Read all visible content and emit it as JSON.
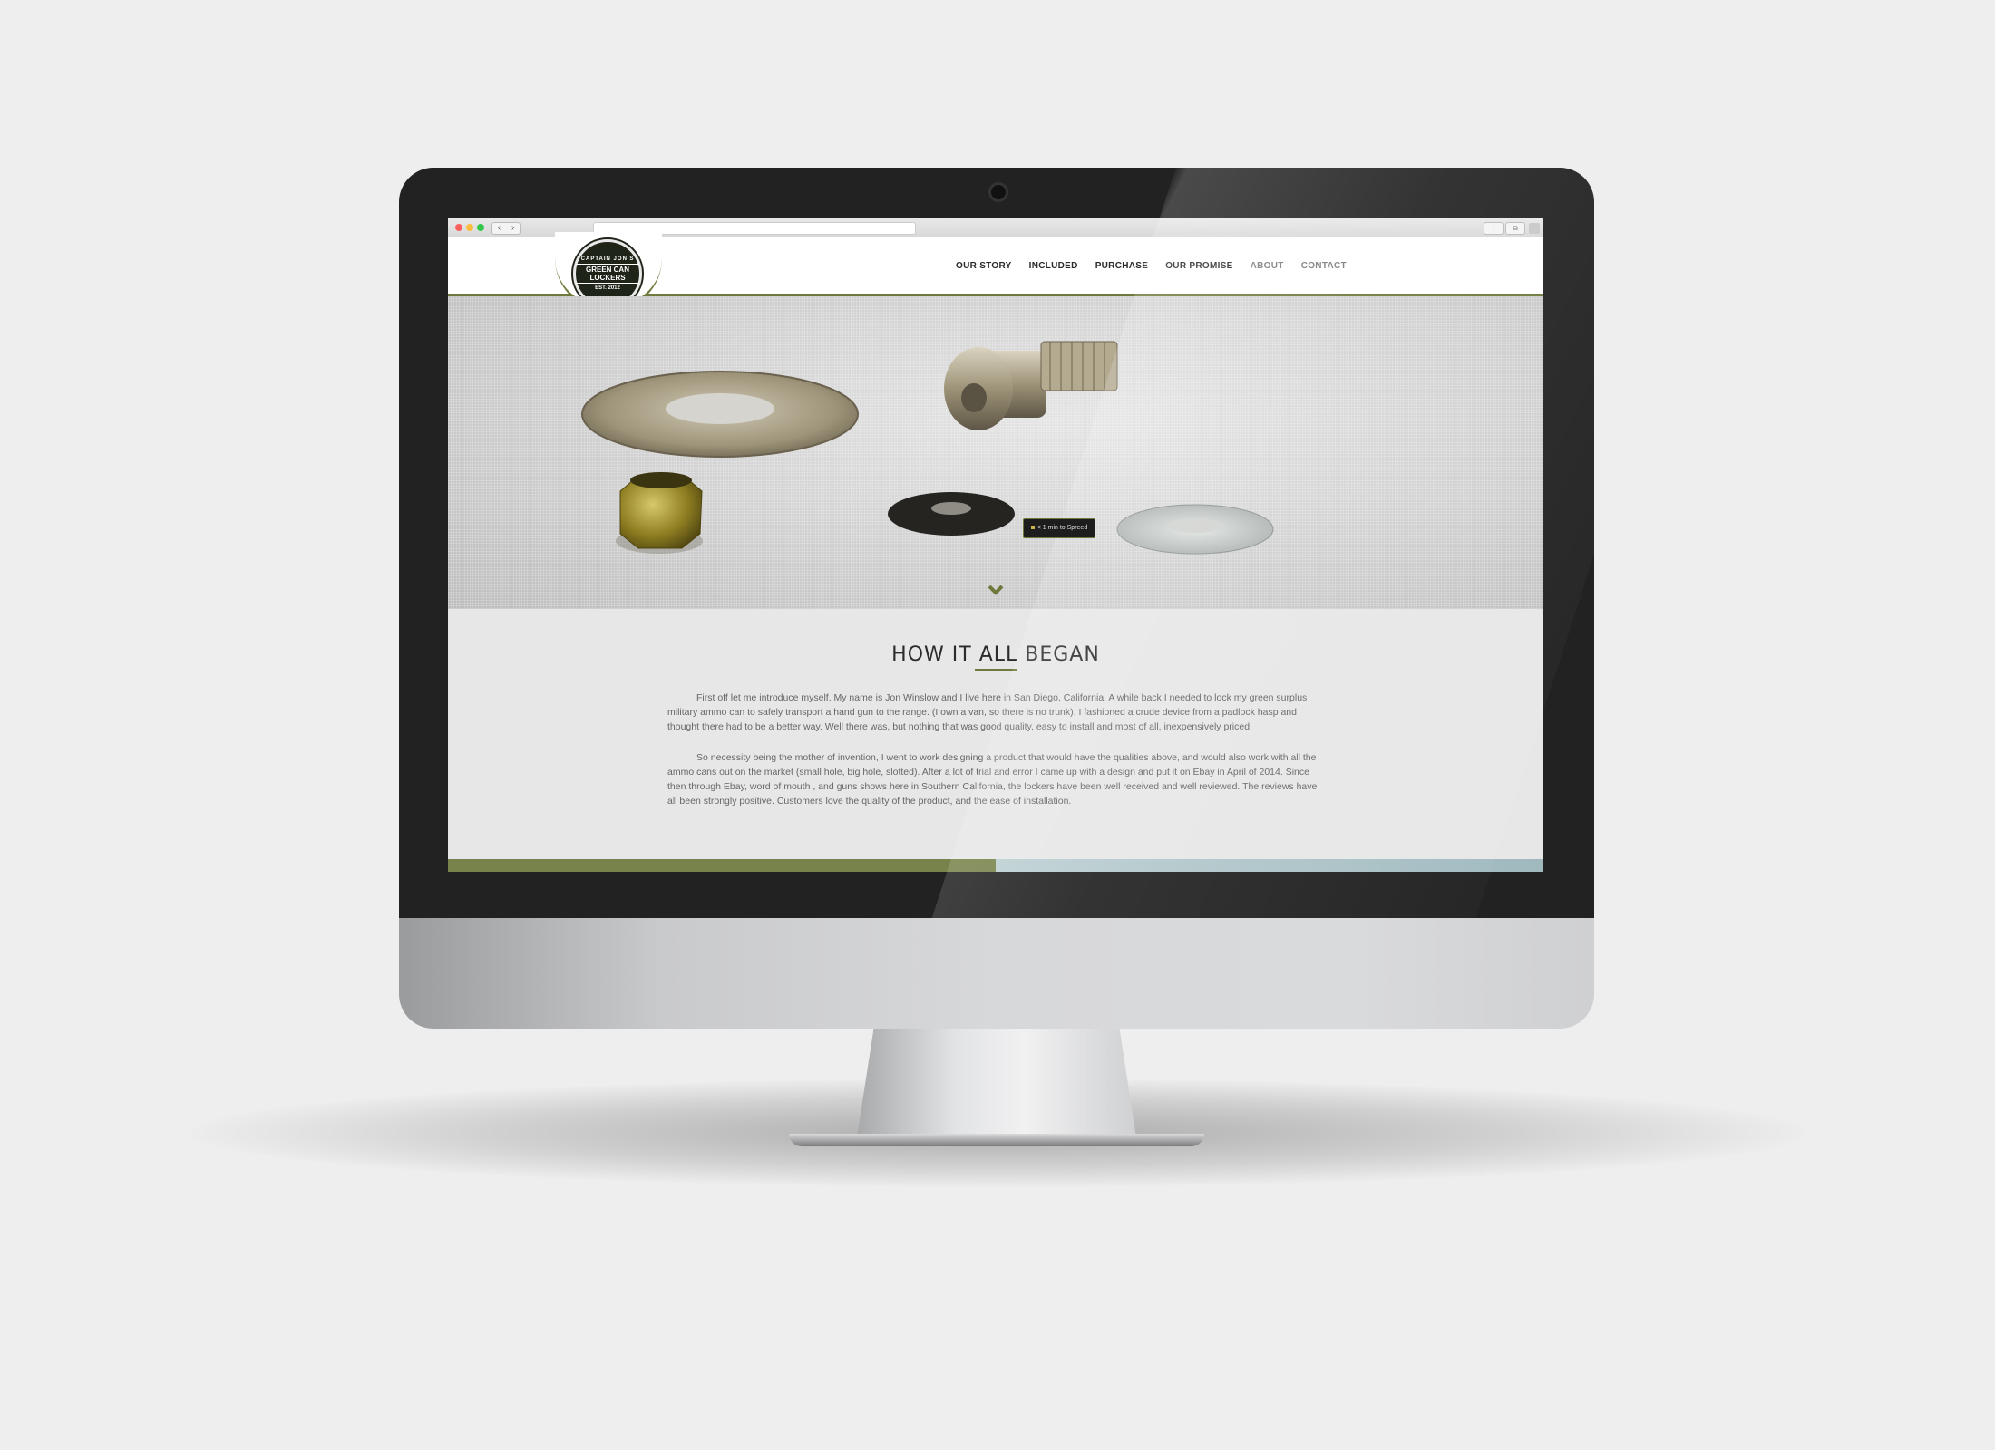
{
  "browser": {
    "back_glyph": "‹",
    "forward_glyph": "›",
    "address": ""
  },
  "site": {
    "logo": {
      "top_text": "CAPTAIN JON'S",
      "main_text": "GREEN CAN LOCKERS",
      "est_text": "EST. 2012"
    },
    "nav": [
      {
        "label": "OUR STORY"
      },
      {
        "label": "INCLUDED"
      },
      {
        "label": "PURCHASE"
      },
      {
        "label": "OUR PROMISE"
      },
      {
        "label": "ABOUT"
      },
      {
        "label": "CONTACT"
      }
    ]
  },
  "content": {
    "title": "HOW IT ALL BEGAN",
    "paragraphs": [
      "First off let me introduce myself. My name is Jon Winslow and I live here in San Diego, California. A while back I needed to lock my green surplus military ammo can to safely transport a hand gun to the range. (I own a van, so there is no trunk). I fashioned a crude device from a padlock hasp and thought there had to be a better way. Well there was, but nothing that was good quality, easy to install and most of all, inexpensively priced",
      "So necessity being the mother of invention, I went to work designing a product that would have the qualities above, and would also work with all the ammo cans out on the market (small hole, big hole, slotted). After a lot of trial and error I came up with a design and put it on Ebay in April of 2014. Since then through Ebay, word of mouth , and guns shows here in Southern California, the lockers have been well received and well reviewed. The reviews have all been strongly positive. Customers love the quality of the product, and the ease of installation."
    ],
    "speed_badge": "< 1 min to Spreed"
  },
  "colors": {
    "accent_green": "#6d7a3b",
    "footer_blue": "#a9c3c8"
  }
}
